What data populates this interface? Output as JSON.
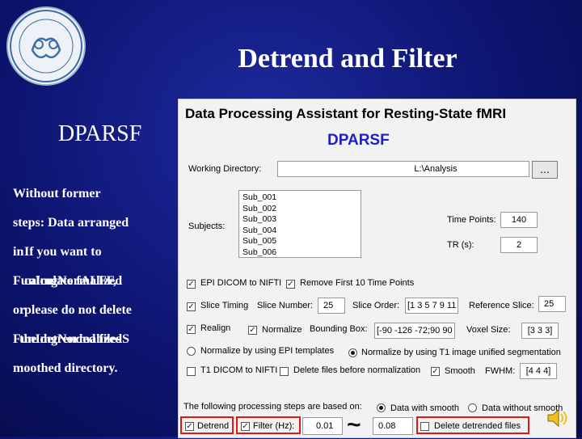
{
  "slide": {
    "title": "Detrend and Filter",
    "subtitle": "DPARSF",
    "body_lines": [
      {
        "a": "Without former",
        "b": ""
      },
      {
        "a": "steps: Data arranged",
        "b": ""
      },
      {
        "a": "in",
        "b": "If you want to"
      },
      {
        "a": "FunImgNormalized",
        "b": "calculate fALFF,"
      },
      {
        "a": "or",
        "b": "please do not delete"
      },
      {
        "a": "FunImgNormalizedS",
        "b": "the detrended files"
      },
      {
        "a": "moothed directory.",
        "b": ""
      }
    ]
  },
  "panel": {
    "title": "Data Processing Assistant for Resting-State fMRI",
    "brand": "DPARSF",
    "working_dir_label": "Working Directory:",
    "working_dir_value": "L:\\Analysis",
    "browse_label": "...",
    "subjects_label": "Subjects:",
    "subjects": [
      "Sub_001",
      "Sub_002",
      "Sub_003",
      "Sub_004",
      "Sub_005",
      "Sub_006"
    ],
    "time_points_label": "Time Points:",
    "time_points": "140",
    "tr_label": "TR (s):",
    "tr": "2",
    "epi_dicom": "EPI DICOM to NIFTI",
    "remove_first": "Remove First 10 Time Points",
    "slice_timing": "Slice Timing",
    "slice_number_label": "Slice Number:",
    "slice_number": "25",
    "slice_order_label": "Slice Order:",
    "slice_order": "[1 3 5 7 9 11",
    "ref_slice_label": "Reference Slice:",
    "ref_slice": "25",
    "realign": "Realign",
    "normalize": "Normalize",
    "bbox_label": "Bounding Box:",
    "bbox": "[-90 -126 -72;90 90",
    "voxel_label": "Voxel Size:",
    "voxel": "[3 3 3]",
    "norm_epi": "Normalize by using EPI templates",
    "norm_t1": "Normalize by using T1 image unified segmentation",
    "t1_dicom": "T1 DICOM to NIFTI",
    "delete_before_norm": "Delete files before normalization",
    "smooth": "Smooth",
    "fwhm_label": "FWHM:",
    "fwhm": "[4 4 4]",
    "following_label": "The following processing steps are based on:",
    "data_with_smooth": "Data with smooth",
    "data_without_smooth": "Data without smooth",
    "detrend": "Detrend",
    "filter_label": "Filter (Hz):",
    "filter_low": "0.01",
    "tilde": "~",
    "filter_high": "0.08",
    "delete_detrended": "Delete detrended files"
  }
}
